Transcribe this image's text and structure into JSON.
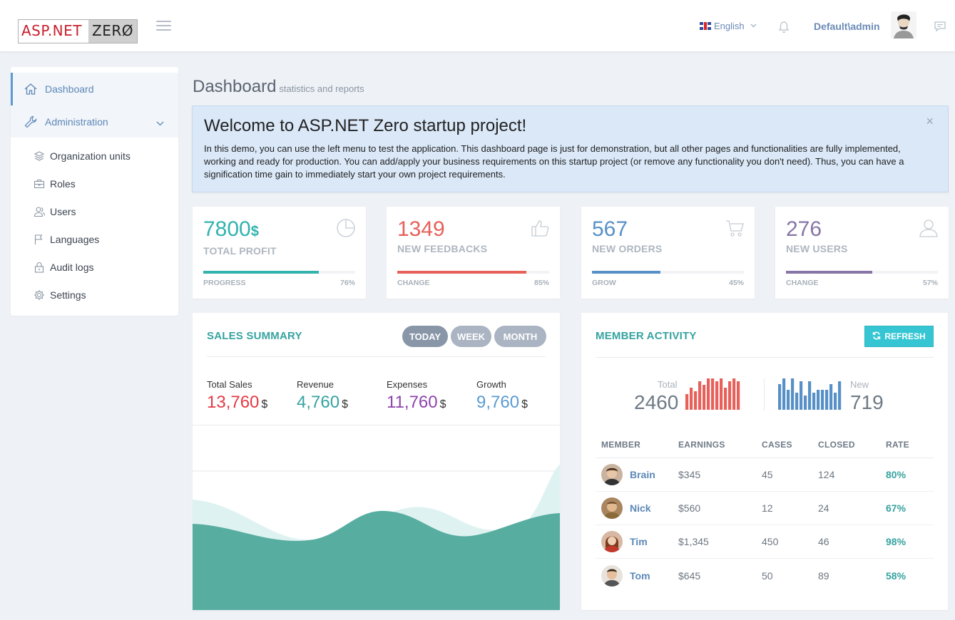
{
  "header": {
    "logo_part1": "ASP.NET",
    "logo_part2": "ZERØ",
    "language": "English",
    "username": "Default\\admin"
  },
  "sidebar": {
    "items": [
      {
        "label": "Dashboard",
        "icon": "home-icon"
      },
      {
        "label": "Administration",
        "icon": "wrench-icon"
      }
    ],
    "subitems": [
      {
        "label": "Organization units",
        "icon": "layers-icon"
      },
      {
        "label": "Roles",
        "icon": "briefcase-icon"
      },
      {
        "label": "Users",
        "icon": "users-icon"
      },
      {
        "label": "Languages",
        "icon": "flag-icon"
      },
      {
        "label": "Audit logs",
        "icon": "lock-icon"
      },
      {
        "label": "Settings",
        "icon": "gear-icon"
      }
    ]
  },
  "page": {
    "title": "Dashboard",
    "subtitle": "statistics and reports"
  },
  "welcome": {
    "title": "Welcome to ASP.NET Zero startup project!",
    "text": "In this demo, you can use the left menu to test the application. This dashboard page is just for demonstration, but all other pages and functionalities are fully implemented, working and ready for production. You can add/apply your business requirements on this startup project (or remove any functionality you don't need). Thus, you can have a signification time gain to immediately start your own project requirements.",
    "close": "×"
  },
  "stats": [
    {
      "value": "7800",
      "unit": "$",
      "label": "TOTAL PROFIT",
      "footer_label": "PROGRESS",
      "percent_text": "76%",
      "percent": 76,
      "color": "#32b3ae",
      "icon": "pie-chart-icon"
    },
    {
      "value": "1349",
      "unit": "",
      "label": "NEW FEEDBACKS",
      "footer_label": "CHANGE",
      "percent_text": "85%",
      "percent": 85,
      "color": "#e7605a",
      "icon": "thumbs-up-icon"
    },
    {
      "value": "567",
      "unit": "",
      "label": "NEW ORDERS",
      "footer_label": "GROW",
      "percent_text": "45%",
      "percent": 45,
      "color": "#5790c6",
      "icon": "cart-icon"
    },
    {
      "value": "276",
      "unit": "",
      "label": "NEW USERS",
      "footer_label": "CHANGE",
      "percent_text": "57%",
      "percent": 57,
      "color": "#8775a7",
      "icon": "user-icon"
    }
  ],
  "sales": {
    "title": "SALES SUMMARY",
    "buttons": [
      "TODAY",
      "WEEK",
      "MONTH"
    ],
    "kpis": [
      {
        "label": "Total Sales",
        "value": "13,760",
        "currency": "$",
        "color": "#e43a45"
      },
      {
        "label": "Revenue",
        "value": "4,760",
        "currency": "$",
        "color": "#36a3a0"
      },
      {
        "label": "Expenses",
        "value": "11,760",
        "currency": "$",
        "color": "#8e44ad"
      },
      {
        "label": "Growth",
        "value": "9,760",
        "currency": "$",
        "color": "#5c9bd1"
      }
    ]
  },
  "member": {
    "title": "MEMBER ACTIVITY",
    "refresh": "REFRESH",
    "total_label": "Total",
    "total_value": "2460",
    "new_label": "New",
    "new_value": "719",
    "total_bars": [
      5,
      7,
      6,
      9,
      8,
      10,
      10,
      9,
      10,
      7,
      9,
      10,
      9
    ],
    "new_bars": [
      9,
      11,
      7,
      11,
      6,
      10,
      5,
      10,
      6,
      7,
      7,
      7,
      9,
      6,
      10
    ],
    "columns": [
      "MEMBER",
      "EARNINGS",
      "CASES",
      "CLOSED",
      "RATE"
    ],
    "rows": [
      {
        "name": "Brain",
        "earnings": "$345",
        "cases": "45",
        "closed": "124",
        "rate": "80%"
      },
      {
        "name": "Nick",
        "earnings": "$560",
        "cases": "12",
        "closed": "24",
        "rate": "67%"
      },
      {
        "name": "Tim",
        "earnings": "$1,345",
        "cases": "450",
        "closed": "46",
        "rate": "98%"
      },
      {
        "name": "Tom",
        "earnings": "$645",
        "cases": "50",
        "closed": "89",
        "rate": "58%"
      }
    ]
  }
}
